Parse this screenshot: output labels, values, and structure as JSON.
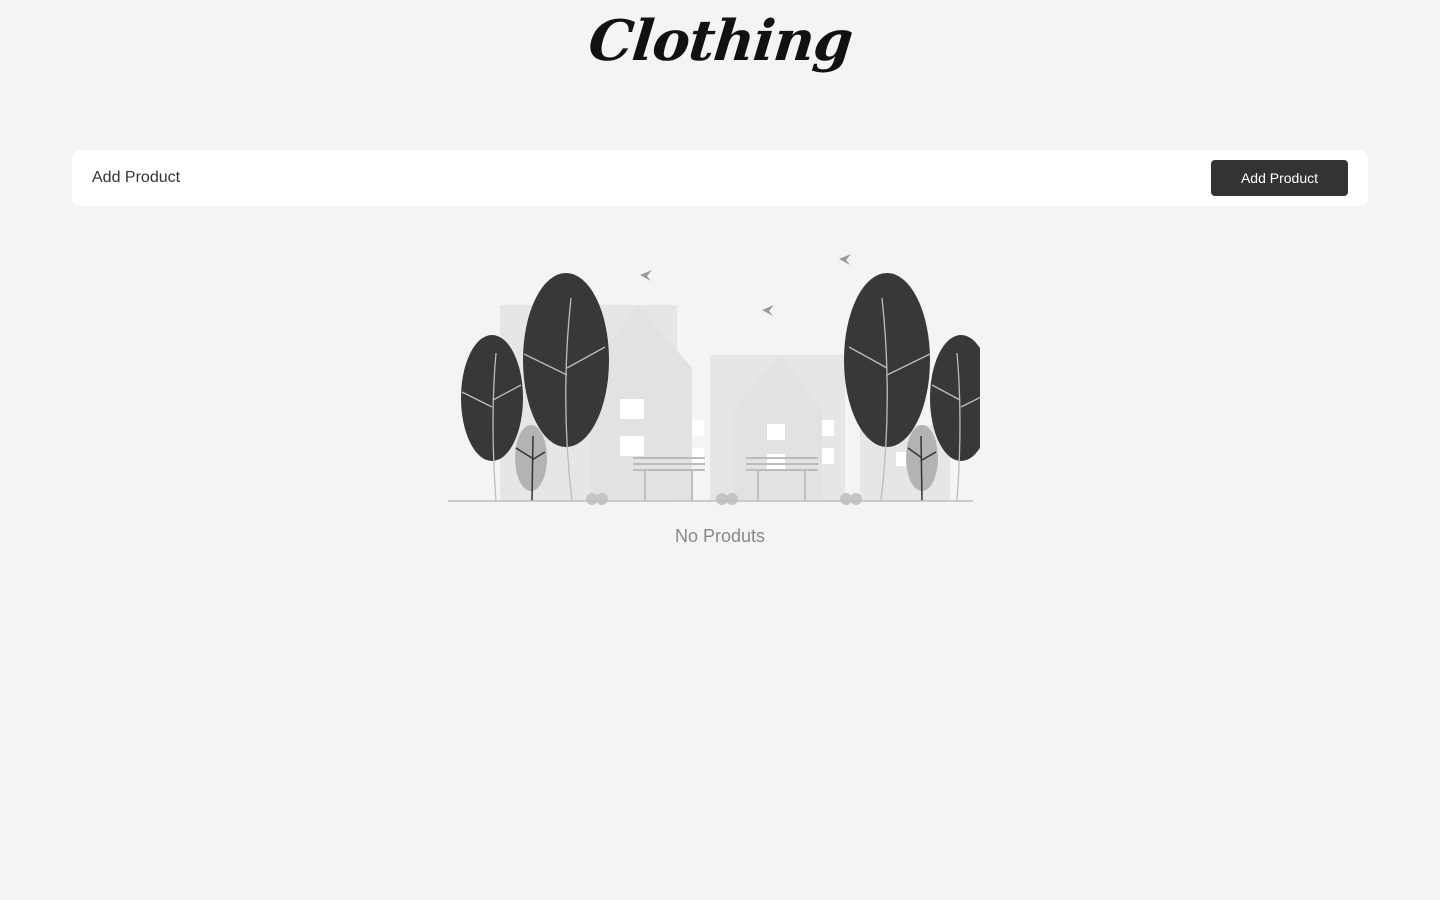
{
  "header": {
    "logo_text": "Clothing"
  },
  "toolbar": {
    "title": "Add Product",
    "add_button_label": "Add Product"
  },
  "empty_state": {
    "message": "No Produts",
    "illustration": "empty-park-illustration"
  },
  "colors": {
    "background": "#f4f4f4",
    "card": "#ffffff",
    "button": "#333333",
    "button_text": "#ffffff",
    "muted_text": "#888888",
    "tree": "#383838"
  }
}
